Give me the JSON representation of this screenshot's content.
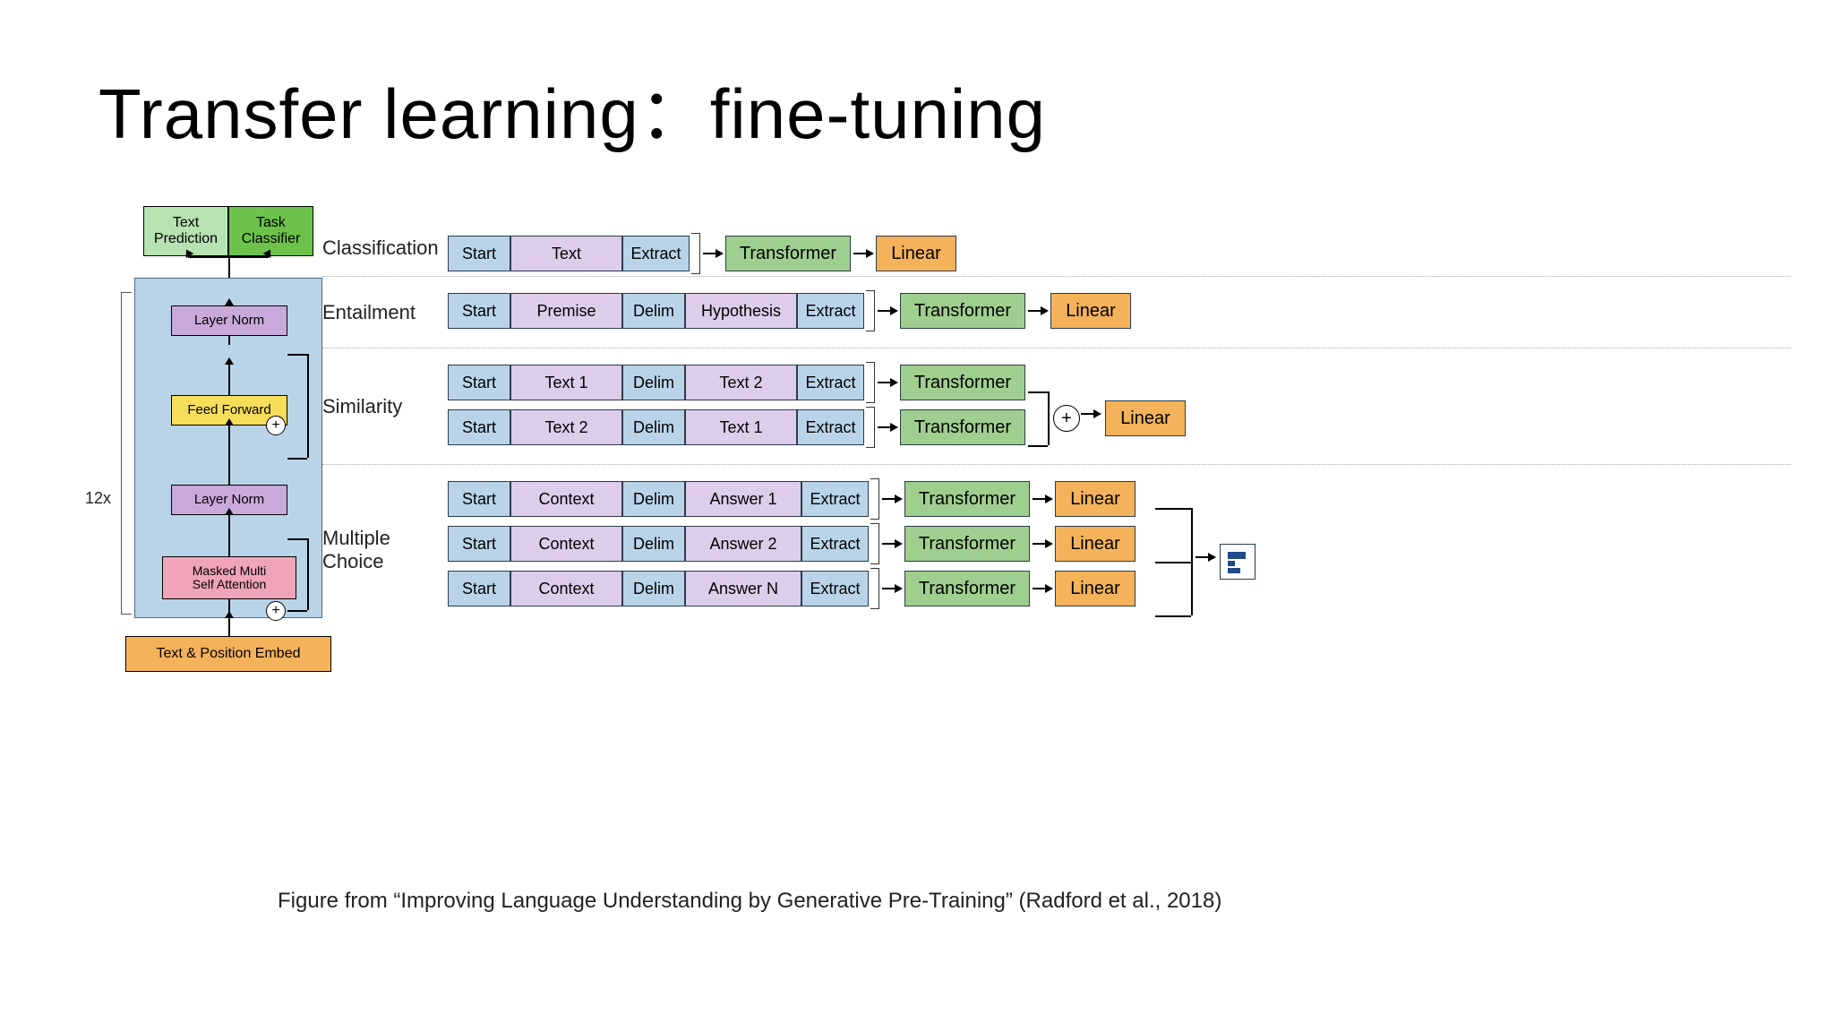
{
  "title": "Transfer learning：fine-tuning",
  "caption_prefix": "Figure from ",
  "caption_quote": "“Improving Language Understanding by Generative Pre-Training”",
  "caption_suffix": " (Radford et al., 2018)",
  "arch": {
    "repeat_label": "12x",
    "head_pred": "Text\nPrediction",
    "head_task": "Task\nClassifier",
    "layer_norm": "Layer Norm",
    "feed_forward": "Feed Forward",
    "mmsa_l1": "Masked Multi",
    "mmsa_l2": "Self Attention",
    "embed": "Text & Position Embed",
    "plus": "+"
  },
  "tok": {
    "start": "Start",
    "delim": "Delim",
    "extract": "Extract",
    "text": "Text",
    "text1": "Text 1",
    "text2": "Text 2",
    "premise": "Premise",
    "hypothesis": "Hypothesis",
    "context": "Context",
    "answer1": "Answer 1",
    "answer2": "Answer 2",
    "answerN": "Answer N"
  },
  "mod": {
    "transformer": "Transformer",
    "linear": "Linear",
    "plus": "+"
  },
  "tasks": {
    "classification": "Classification",
    "entailment": "Entailment",
    "similarity": "Similarity",
    "multiple_choice": "Multiple Choice"
  }
}
